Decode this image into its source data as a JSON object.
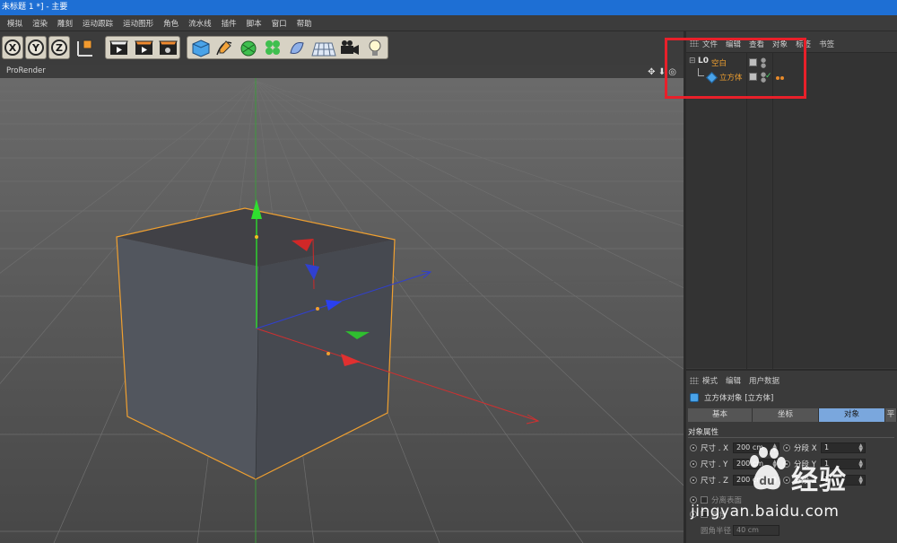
{
  "window": {
    "title": "未标题 1 *] - 主要"
  },
  "menubar": {
    "items": [
      "模拟",
      "渲染",
      "雕刻",
      "运动跟踪",
      "运动图形",
      "角色",
      "流水线",
      "插件",
      "脚本",
      "窗口",
      "帮助"
    ]
  },
  "toolbar": {
    "axis_buttons": [
      "X",
      "Y",
      "Z"
    ],
    "icons": [
      "coordinate-system-icon",
      "render-view-icon",
      "render-picture-viewer-icon",
      "render-settings-icon",
      "cube-primitive-icon",
      "pen-spline-icon",
      "subdivision-generator-icon",
      "cloner-icon",
      "deformer-icon",
      "floor-environment-icon",
      "camera-icon",
      "light-icon"
    ]
  },
  "viewport": {
    "header_label": "ProRender",
    "controls": "✥ ⬇ ◎"
  },
  "object_manager": {
    "menu": [
      "文件",
      "编辑",
      "查看",
      "对象",
      "标签",
      "书签"
    ],
    "objects": [
      {
        "name": "空白",
        "icon": "null-object-icon"
      },
      {
        "name": "立方体",
        "icon": "cube-object-icon"
      }
    ]
  },
  "attribute_manager": {
    "menu": [
      "模式",
      "编辑",
      "用户数据"
    ],
    "object_title": "立方体对象 [立方体]",
    "tabs": [
      "基本",
      "坐标",
      "对象",
      "平"
    ],
    "active_tab": "对象",
    "section_title": "对象属性",
    "fields": [
      {
        "label": "尺寸 . X",
        "value": "200 cm",
        "seg_label": "分段 X",
        "seg_value": "1"
      },
      {
        "label": "尺寸 . Y",
        "value": "200 cm",
        "seg_label": "分段 Y",
        "seg_value": "1"
      },
      {
        "label": "尺寸 . Z",
        "value": "200 cm",
        "seg_label": "分段 Z",
        "seg_value": "1"
      }
    ],
    "separate_surfaces": "分离表面",
    "fillet_label": "圆角",
    "fillet_radius_label": "圆角半径",
    "fillet_radius_value": "40 cm"
  },
  "watermark": {
    "brand": "经验",
    "url": "jingyan.baidu.com"
  },
  "colors": {
    "titlebar": "#1e6fd4",
    "highlight": "#e8202a",
    "selection": "#f0a030",
    "active_tab": "#7aa7dd"
  }
}
